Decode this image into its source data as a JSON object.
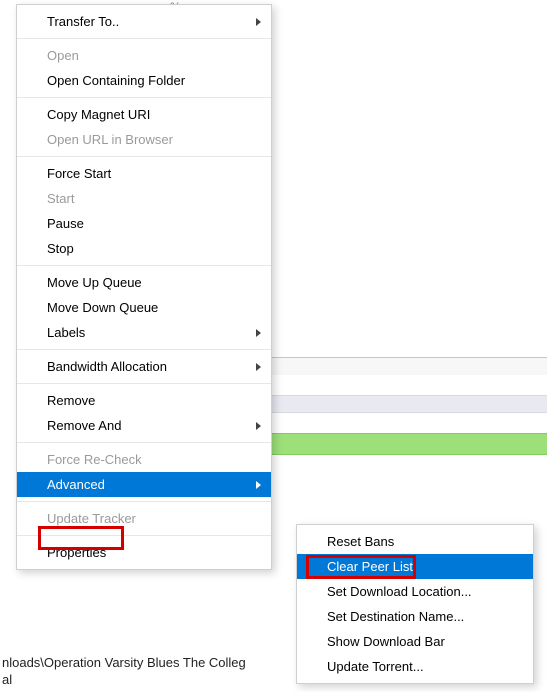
{
  "background": {
    "status_fragment": "%",
    "path_fragment_line1": "nloads\\Operation Varsity Blues The Colleg",
    "path_fragment_line2": "al"
  },
  "main_menu": [
    {
      "label": "Transfer To..",
      "enabled": true,
      "submenu": true
    },
    {
      "sep": true
    },
    {
      "label": "Open",
      "enabled": false
    },
    {
      "label": "Open Containing Folder",
      "enabled": true
    },
    {
      "sep": true
    },
    {
      "label": "Copy Magnet URI",
      "enabled": true
    },
    {
      "label": "Open URL in Browser",
      "enabled": false
    },
    {
      "sep": true
    },
    {
      "label": "Force Start",
      "enabled": true
    },
    {
      "label": "Start",
      "enabled": false
    },
    {
      "label": "Pause",
      "enabled": true
    },
    {
      "label": "Stop",
      "enabled": true
    },
    {
      "sep": true
    },
    {
      "label": "Move Up Queue",
      "enabled": true
    },
    {
      "label": "Move Down Queue",
      "enabled": true
    },
    {
      "label": "Labels",
      "enabled": true,
      "submenu": true
    },
    {
      "sep": true
    },
    {
      "label": "Bandwidth Allocation",
      "enabled": true,
      "submenu": true
    },
    {
      "sep": true
    },
    {
      "label": "Remove",
      "enabled": true
    },
    {
      "label": "Remove And",
      "enabled": true,
      "submenu": true
    },
    {
      "sep": true
    },
    {
      "label": "Force Re-Check",
      "enabled": false
    },
    {
      "label": "Advanced",
      "enabled": true,
      "submenu": true,
      "selected": true
    },
    {
      "sep": true
    },
    {
      "label": "Update Tracker",
      "enabled": false
    },
    {
      "sep": true
    },
    {
      "label": "Properties",
      "enabled": true
    }
  ],
  "sub_menu": [
    {
      "label": "Reset Bans",
      "enabled": true
    },
    {
      "label": "Clear Peer List",
      "enabled": true,
      "selected": true
    },
    {
      "label": "Set Download Location...",
      "enabled": true
    },
    {
      "label": "Set Destination Name...",
      "enabled": true
    },
    {
      "label": "Show Download Bar",
      "enabled": true
    },
    {
      "label": "Update Torrent...",
      "enabled": true
    }
  ]
}
